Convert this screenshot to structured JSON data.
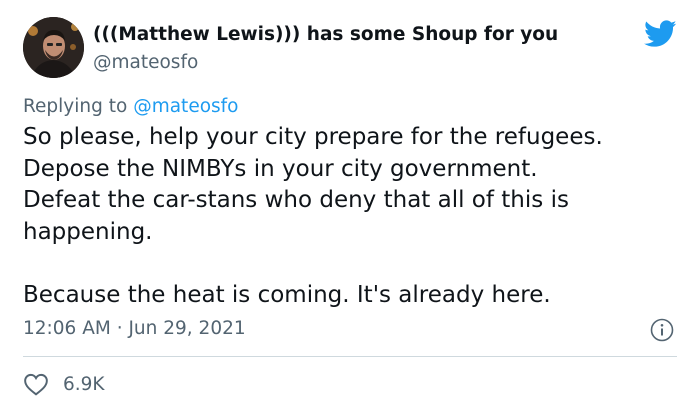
{
  "author": {
    "display_name": "(((Matthew Lewis))) has some Shoup for you",
    "handle": "@mateosfo"
  },
  "reply": {
    "prefix": "Replying to",
    "mention": "@mateosfo"
  },
  "tweet": {
    "paragraph_1": "So please, help your city prepare for the refugees.\nDepose the NIMBYs in your city government.\nDefeat the car-stans who deny that all of this is\nhappening.",
    "paragraph_2": "Because the heat is coming. It's already here."
  },
  "meta": {
    "timestamp": "12:06 AM · Jun 29, 2021"
  },
  "stats": {
    "likes": "6.9K"
  },
  "colors": {
    "brand": "#1d9bf0",
    "text": "#0f1419",
    "secondary": "#536471",
    "divider": "#cfd9de"
  },
  "icons": {
    "platform": "twitter-bird-icon",
    "info": "info-icon",
    "like": "heart-icon"
  }
}
